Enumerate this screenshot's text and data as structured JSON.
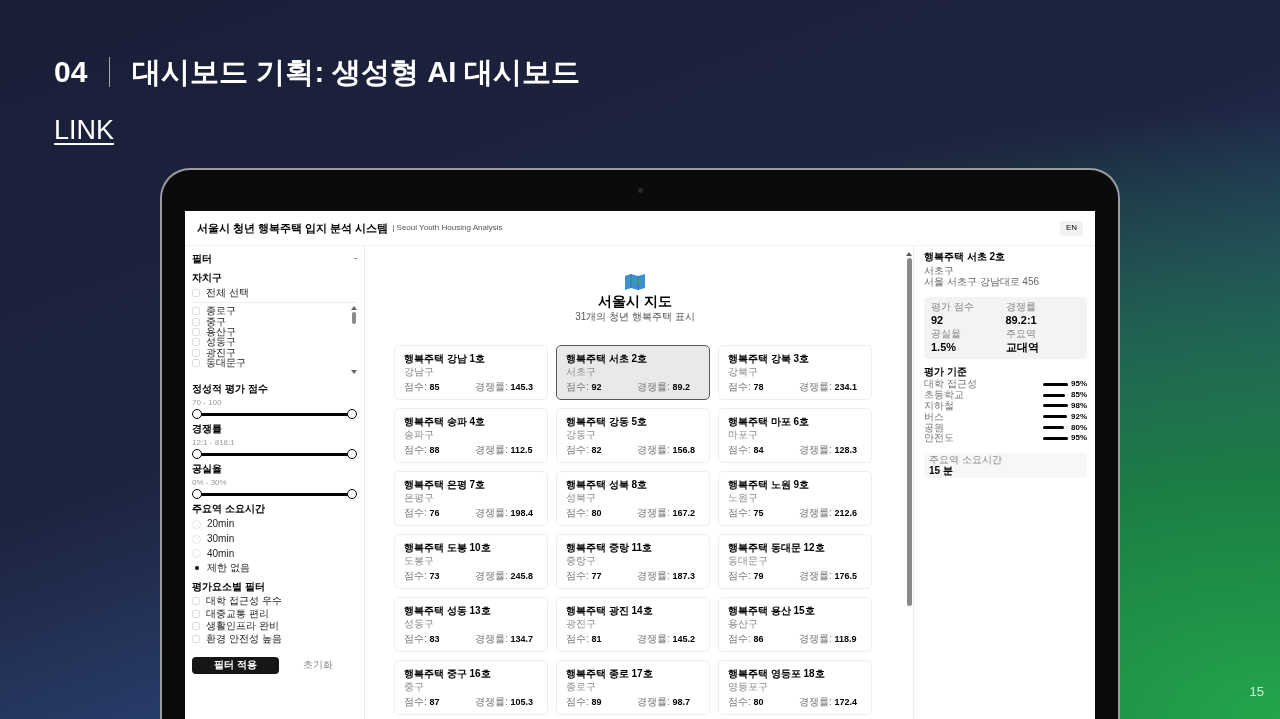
{
  "slide": {
    "number": "04",
    "title": "대시보드 기획: 생성형 AI 대시보드",
    "link": "LINK",
    "page": "15"
  },
  "app": {
    "title": "서울시 청년 행복주택 입지 분석 시스템",
    "subtitle": "| Seoul Youth Housing Analysis",
    "language_button": "EN"
  },
  "filters": {
    "title": "필터",
    "collapse": "-",
    "district": {
      "label": "자치구",
      "select_all": {
        "label": "전체 선택",
        "checked": false
      },
      "items": [
        {
          "label": "종로구",
          "checked": false
        },
        {
          "label": "중구",
          "checked": false
        },
        {
          "label": "용산구",
          "checked": false
        },
        {
          "label": "성동구",
          "checked": false
        },
        {
          "label": "광진구",
          "checked": false
        },
        {
          "label": "동대문구",
          "checked": false
        }
      ]
    },
    "sliders": [
      {
        "label": "정성적 평가 점수",
        "range": "70 - 100",
        "level": 1
      },
      {
        "label": "경쟁률",
        "range": "12:1 - 818:1",
        "level": 1
      },
      {
        "label": "공실율",
        "range": "0% - 30%",
        "level": 1
      }
    ],
    "travel_time": {
      "label": "주요역 소요시간",
      "options": [
        {
          "label": "20min",
          "selected": false
        },
        {
          "label": "30min",
          "selected": false
        },
        {
          "label": "40min",
          "selected": false
        },
        {
          "label": "제한 없음",
          "selected": true
        }
      ]
    },
    "criteria_filter": {
      "label": "평가요소별 필터",
      "items": [
        {
          "label": "대학 접근성 우수",
          "checked": false
        },
        {
          "label": "대중교통 편리",
          "checked": false
        },
        {
          "label": "생활인프라 완비",
          "checked": false
        },
        {
          "label": "환경 안전성 높음",
          "checked": false
        }
      ]
    },
    "apply_button": "필터 적용",
    "reset_button": "초기화"
  },
  "map": {
    "title": "서울시 지도",
    "subtitle": "31개의 청년 행복주택 표시"
  },
  "cards": [
    {
      "name": "행복주택 강남 1호",
      "district": "강남구",
      "score_label": "점수:",
      "score": "85",
      "competition_label": "경쟁률:",
      "competition": "145.3",
      "selected": false
    },
    {
      "name": "행복주택 서초 2호",
      "district": "서초구",
      "score_label": "점수:",
      "score": "92",
      "competition_label": "경쟁률:",
      "competition": "89.2",
      "selected": true
    },
    {
      "name": "행복주택 강북 3호",
      "district": "강북구",
      "score_label": "점수:",
      "score": "78",
      "competition_label": "경쟁률:",
      "competition": "234.1",
      "selected": false
    },
    {
      "name": "행복주택 송파 4호",
      "district": "송파구",
      "score_label": "점수:",
      "score": "88",
      "competition_label": "경쟁률:",
      "competition": "112.5",
      "selected": false
    },
    {
      "name": "행복주택 강동 5호",
      "district": "강동구",
      "score_label": "점수:",
      "score": "82",
      "competition_label": "경쟁률:",
      "competition": "156.8",
      "selected": false
    },
    {
      "name": "행복주택 마포 6호",
      "district": "마포구",
      "score_label": "점수:",
      "score": "84",
      "competition_label": "경쟁률:",
      "competition": "128.3",
      "selected": false
    },
    {
      "name": "행복주택 은평 7호",
      "district": "은평구",
      "score_label": "점수:",
      "score": "76",
      "competition_label": "경쟁률:",
      "competition": "198.4",
      "selected": false
    },
    {
      "name": "행복주택 성북 8호",
      "district": "성북구",
      "score_label": "점수:",
      "score": "80",
      "competition_label": "경쟁률:",
      "competition": "167.2",
      "selected": false
    },
    {
      "name": "행복주택 노원 9호",
      "district": "노원구",
      "score_label": "점수:",
      "score": "75",
      "competition_label": "경쟁률:",
      "competition": "212.6",
      "selected": false
    },
    {
      "name": "행복주택 도봉 10호",
      "district": "도봉구",
      "score_label": "점수:",
      "score": "73",
      "competition_label": "경쟁률:",
      "competition": "245.8",
      "selected": false
    },
    {
      "name": "행복주택 중랑 11호",
      "district": "중랑구",
      "score_label": "점수:",
      "score": "77",
      "competition_label": "경쟁률:",
      "competition": "187.3",
      "selected": false
    },
    {
      "name": "행복주택 동대문 12호",
      "district": "동대문구",
      "score_label": "점수:",
      "score": "79",
      "competition_label": "경쟁률:",
      "competition": "176.5",
      "selected": false
    },
    {
      "name": "행복주택 성동 13호",
      "district": "성동구",
      "score_label": "점수:",
      "score": "83",
      "competition_label": "경쟁률:",
      "competition": "134.7",
      "selected": false
    },
    {
      "name": "행복주택 광진 14호",
      "district": "광진구",
      "score_label": "점수:",
      "score": "81",
      "competition_label": "경쟁률:",
      "competition": "145.2",
      "selected": false
    },
    {
      "name": "행복주택 용산 15호",
      "district": "용산구",
      "score_label": "점수:",
      "score": "86",
      "competition_label": "경쟁률:",
      "competition": "118.9",
      "selected": false
    },
    {
      "name": "행복주택 중구 16호",
      "district": "중구",
      "score_label": "점수:",
      "score": "87",
      "competition_label": "경쟁률:",
      "competition": "105.3",
      "selected": false
    },
    {
      "name": "행복주택 종로 17호",
      "district": "종로구",
      "score_label": "점수:",
      "score": "89",
      "competition_label": "경쟁률:",
      "competition": "98.7",
      "selected": false
    },
    {
      "name": "행복주택 영등포 18호",
      "district": "영등포구",
      "score_label": "점수:",
      "score": "80",
      "competition_label": "경쟁률:",
      "competition": "172.4",
      "selected": false
    }
  ],
  "detail": {
    "name": "행복주택 서초 2호",
    "district": "서초구",
    "address": "서울 서초구 강남대로 456",
    "stats": [
      {
        "label": "평가 점수",
        "value": "92"
      },
      {
        "label": "경쟁률",
        "value": "89.2:1"
      },
      {
        "label": "공실율",
        "value": "1.5%"
      },
      {
        "label": "주요역",
        "value": "교대역"
      }
    ],
    "criteria_title": "평가 기준",
    "criteria": [
      {
        "label": "대학 접근성",
        "level": 0.95,
        "reading": "95%"
      },
      {
        "label": "초등학교",
        "level": 0.85,
        "reading": "85%"
      },
      {
        "label": "지하철",
        "level": 0.98,
        "reading": "98%"
      },
      {
        "label": "버스",
        "level": 0.92,
        "reading": "92%"
      },
      {
        "label": "공원",
        "level": 0.8,
        "reading": "80%"
      },
      {
        "label": "안전도",
        "level": 0.95,
        "reading": "95%"
      }
    ],
    "travel": {
      "label": "주요역 소요시간",
      "value": "15 분"
    }
  }
}
